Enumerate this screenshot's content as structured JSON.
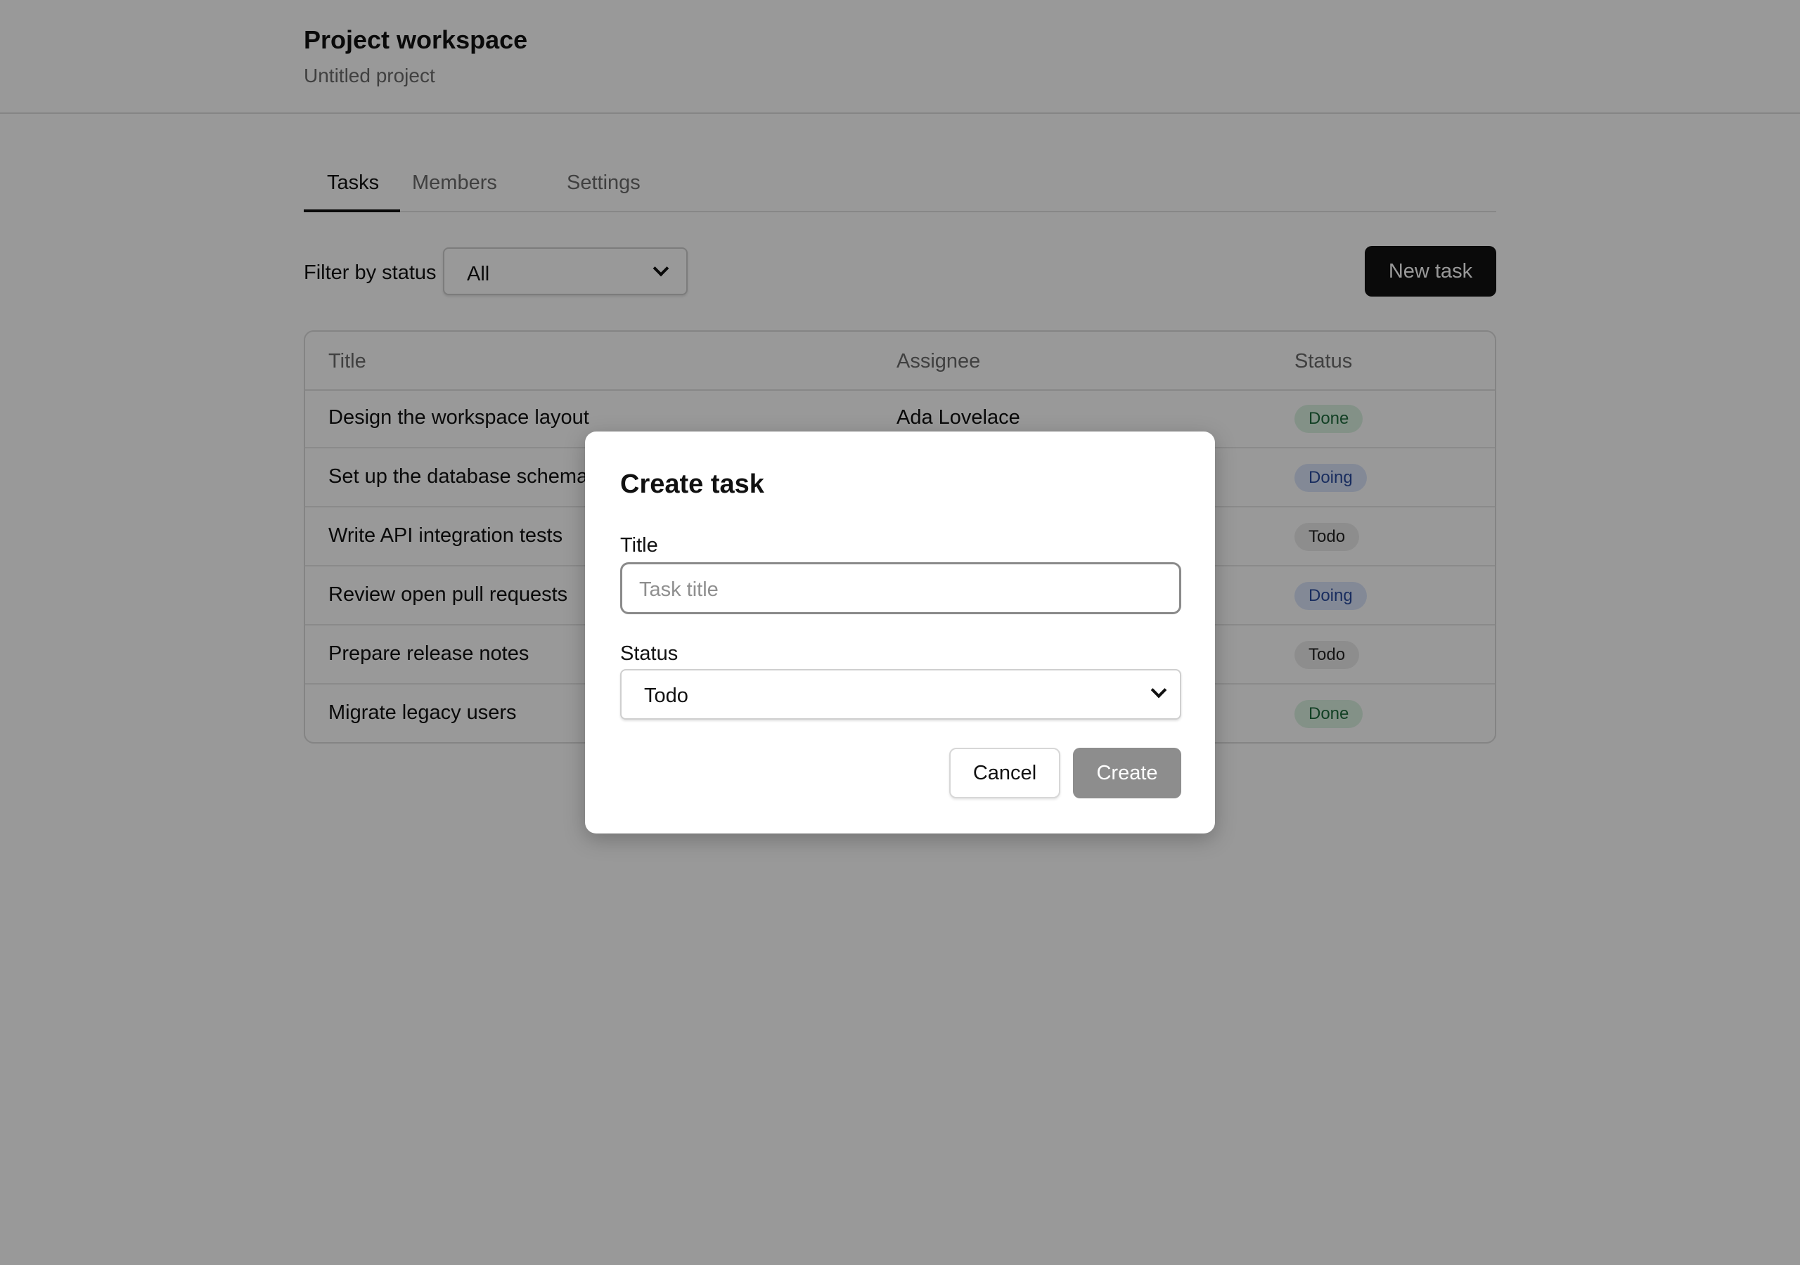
{
  "header": {
    "title": "Project workspace",
    "subtitle": "Untitled project"
  },
  "tabs": [
    {
      "label": "Tasks",
      "active": true
    },
    {
      "label": "Members",
      "active": false
    },
    {
      "label": "Settings",
      "active": false
    }
  ],
  "toolbar": {
    "filter_label": "Filter by status",
    "filter_value": "All",
    "new_task_label": "New task"
  },
  "table": {
    "columns": [
      "Title",
      "Assignee",
      "Status"
    ],
    "rows": [
      {
        "title": "Design the workspace layout",
        "assignee": "Ada Lovelace",
        "status": "Done"
      },
      {
        "title": "Set up the database schema",
        "assignee": "",
        "status": "Doing"
      },
      {
        "title": "Write API integration tests",
        "assignee": "",
        "status": "Todo"
      },
      {
        "title": "Review open pull requests",
        "assignee": "",
        "status": "Doing"
      },
      {
        "title": "Prepare release notes",
        "assignee": "",
        "status": "Todo"
      },
      {
        "title": "Migrate legacy users",
        "assignee": "",
        "status": "Done"
      }
    ]
  },
  "modal": {
    "title": "Create task",
    "title_label": "Title",
    "title_placeholder": "Task title",
    "title_value": "",
    "status_label": "Status",
    "status_value": "Todo",
    "cancel_label": "Cancel",
    "create_label": "Create",
    "create_enabled": false
  },
  "colors": {
    "primary_button": "#111111",
    "overlay": "rgba(0,0,0,0.4)",
    "badge_done_bg": "#daf2e2",
    "badge_doing_bg": "#dbe5fb",
    "badge_todo_bg": "#ececec"
  }
}
